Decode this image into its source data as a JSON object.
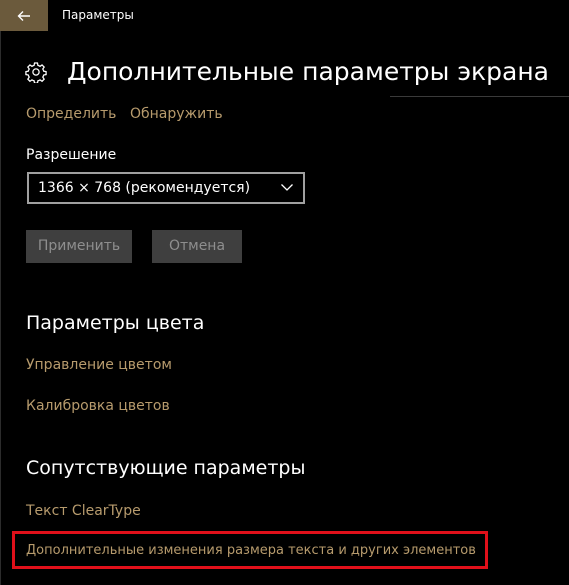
{
  "titlebar": {
    "app_title": "Параметры",
    "back_icon": "arrow-left-icon"
  },
  "header": {
    "icon": "gear-icon",
    "title": "Дополнительные параметры экрана"
  },
  "display_links": {
    "identify": "Определить",
    "detect": "Обнаружить"
  },
  "resolution": {
    "label": "Разрешение",
    "value": "1366 × 768 (рекомендуется)"
  },
  "actions": {
    "apply": "Применить",
    "cancel": "Отмена"
  },
  "color_section": {
    "title": "Параметры цвета",
    "links": [
      "Управление цветом",
      "Калибровка цветов"
    ]
  },
  "related_section": {
    "title": "Сопутствующие параметры",
    "links": [
      "Текст ClearType",
      "Дополнительные изменения размера текста и других элементов"
    ]
  },
  "colors": {
    "accent": "#b79b6d",
    "back_button": "#6b5a3c",
    "highlight": "#e0101a",
    "button_bg": "#3f3f3f"
  }
}
